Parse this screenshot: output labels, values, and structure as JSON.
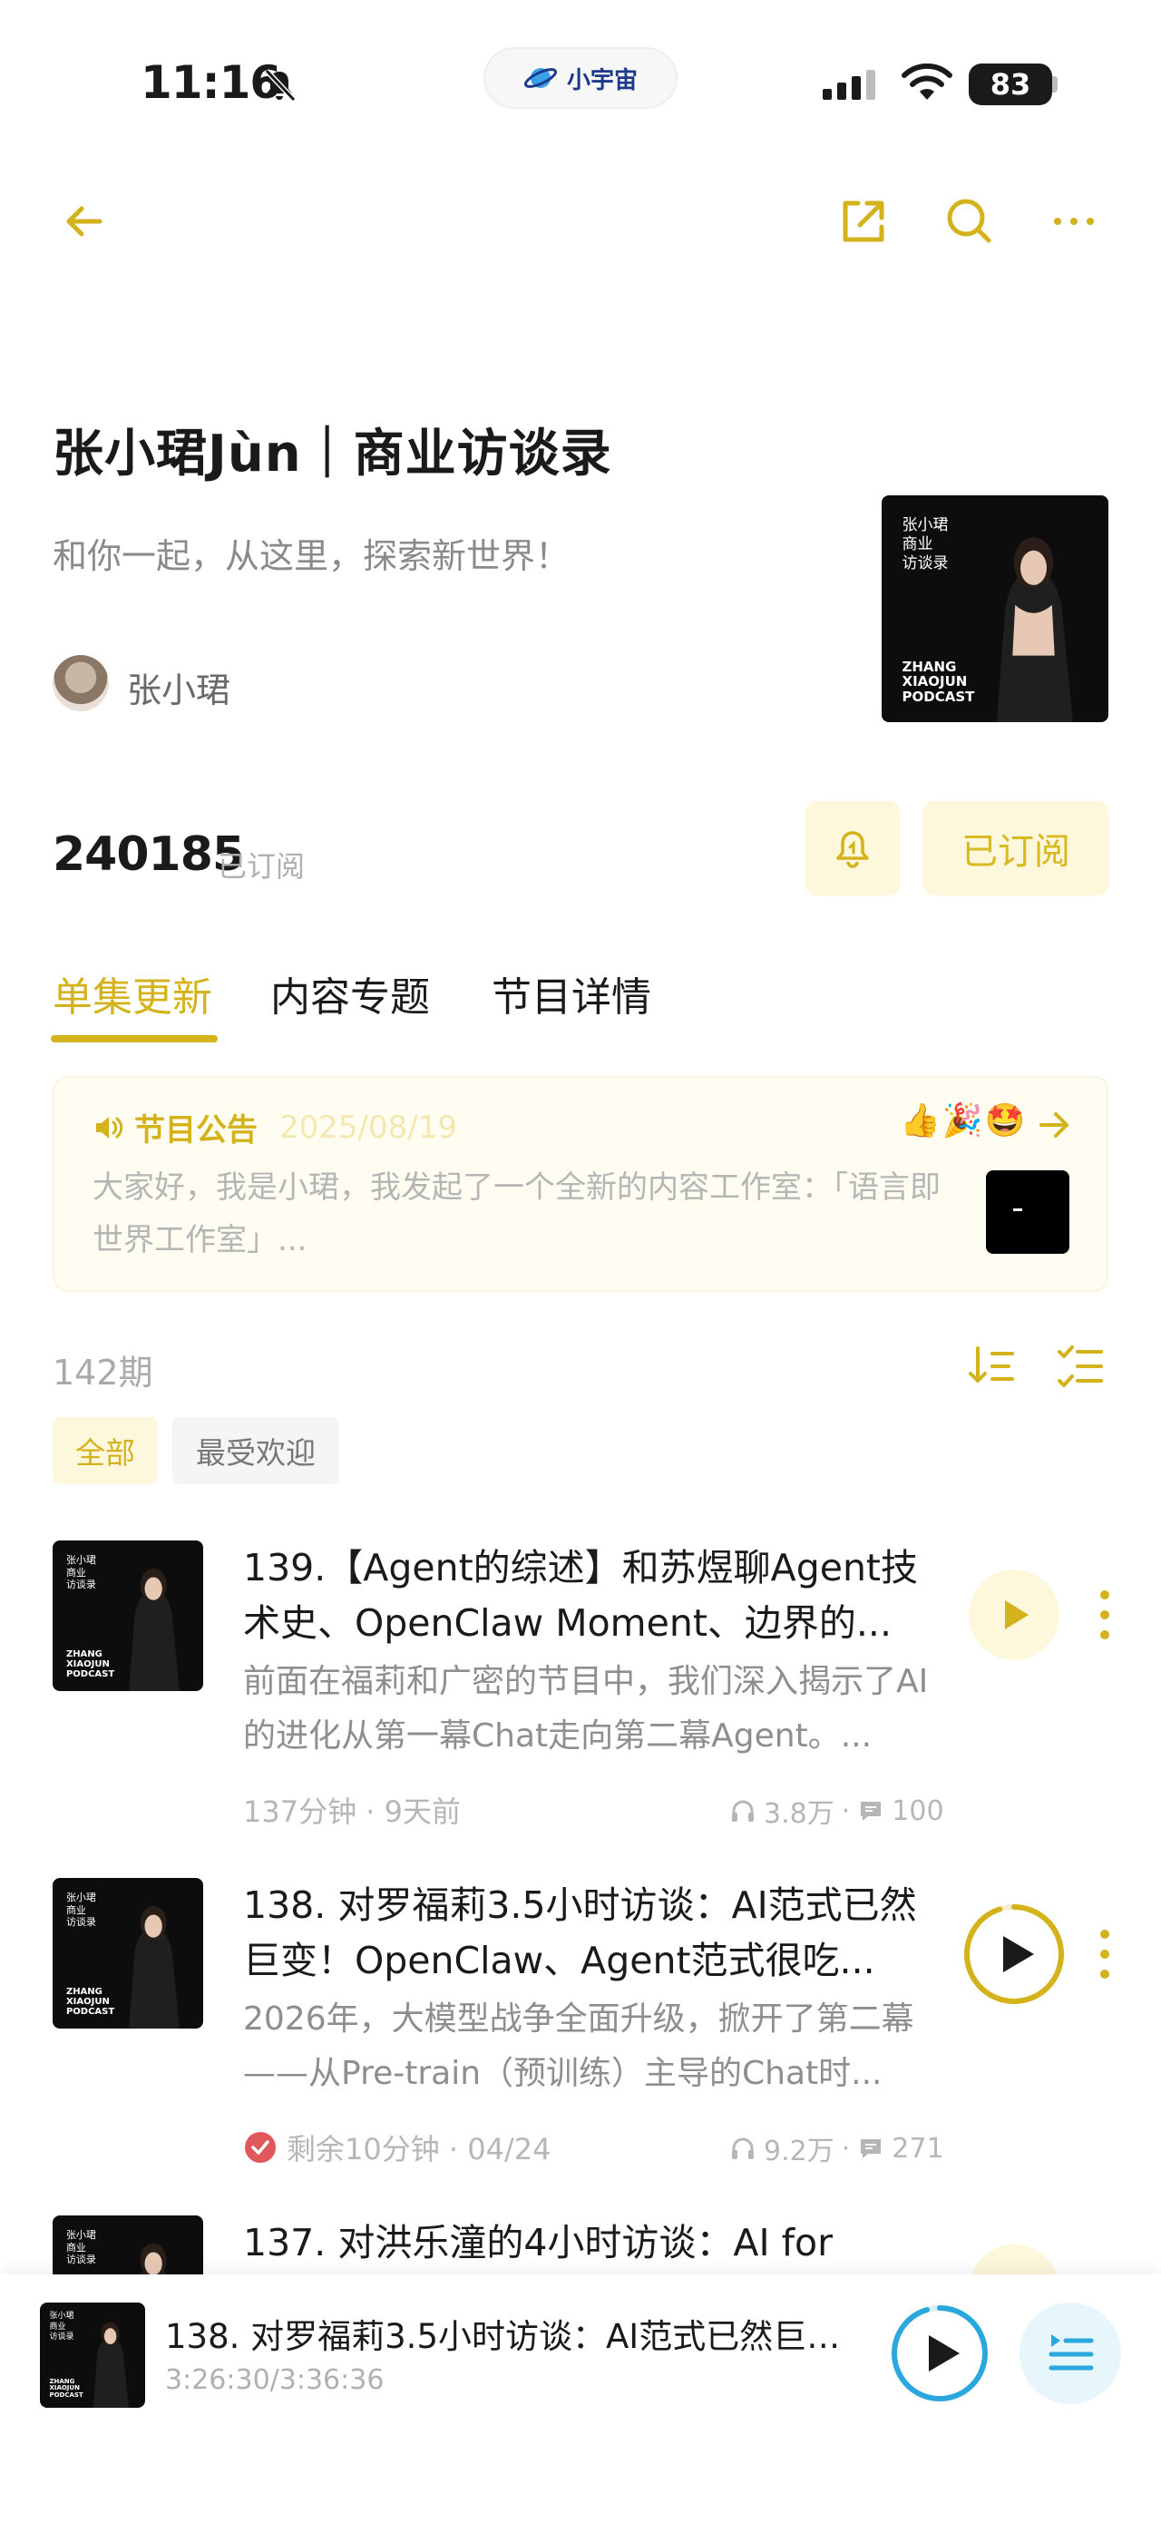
{
  "status_bar": {
    "time": "11:16",
    "app_name": "小宇宙",
    "battery": "83"
  },
  "podcast": {
    "title": "张小珺Jùn｜商业访谈录",
    "subtitle": "和你一起，从这里，探索新世界！",
    "author": "张小珺",
    "cover": {
      "title_lines": [
        "张小珺",
        "商业",
        "访谈录"
      ],
      "footer_lines": [
        "ZHANG",
        "XIAOJUN",
        "PODCAST"
      ]
    },
    "subscriber_count": "240185",
    "subscribed_label": "已订阅",
    "subscribe_button": "已订阅"
  },
  "tabs": [
    {
      "label": "单集更新",
      "active": true
    },
    {
      "label": "内容专题",
      "active": false
    },
    {
      "label": "节目详情",
      "active": false
    }
  ],
  "announcement": {
    "label": "节目公告",
    "date": "2025/08/19",
    "emojis": "👍🎉🤩",
    "text": "大家好，我是小珺，我发起了一个全新的内容工作室：「语言即世界工作室」..."
  },
  "episode_count": "142期",
  "filters": [
    {
      "label": "全部",
      "active": true
    },
    {
      "label": "最受欢迎",
      "active": false
    }
  ],
  "episodes": [
    {
      "title": "139.【Agent的综述】和苏煜聊Agent技术史、OpenClaw Moment、边界的...",
      "description": "前面在福莉和广密的节目中，我们深入揭示了AI的进化从第一幕Chat走向第二幕Agent。...",
      "meta": "137分钟 · 9天前",
      "plays": "3.8万",
      "comments": "100"
    },
    {
      "title": "138. 对罗福莉3.5小时访谈：AI范式已然巨变！OpenClaw、Agent范式很吃...",
      "description": "2026年，大模型战争全面升级，掀开了第二幕——从Pre-train（预训练）主导的Chat时...",
      "meta": "剩余10分钟 · 04/24",
      "plays": "9.2万",
      "comments": "271",
      "progress": 0.95
    },
    {
      "title": "137. 对洪乐潼的4小时访谈：AI for"
    }
  ],
  "mini_player": {
    "title": "138. 对罗福莉3.5小时访谈：AI范式已然巨变...",
    "time": "3:26:30/3:36:36",
    "progress": 0.953
  },
  "colors": {
    "accent": "#d4b21c",
    "accent_bg": "#fdf7dc",
    "player_ring": "#2aa7dd"
  }
}
